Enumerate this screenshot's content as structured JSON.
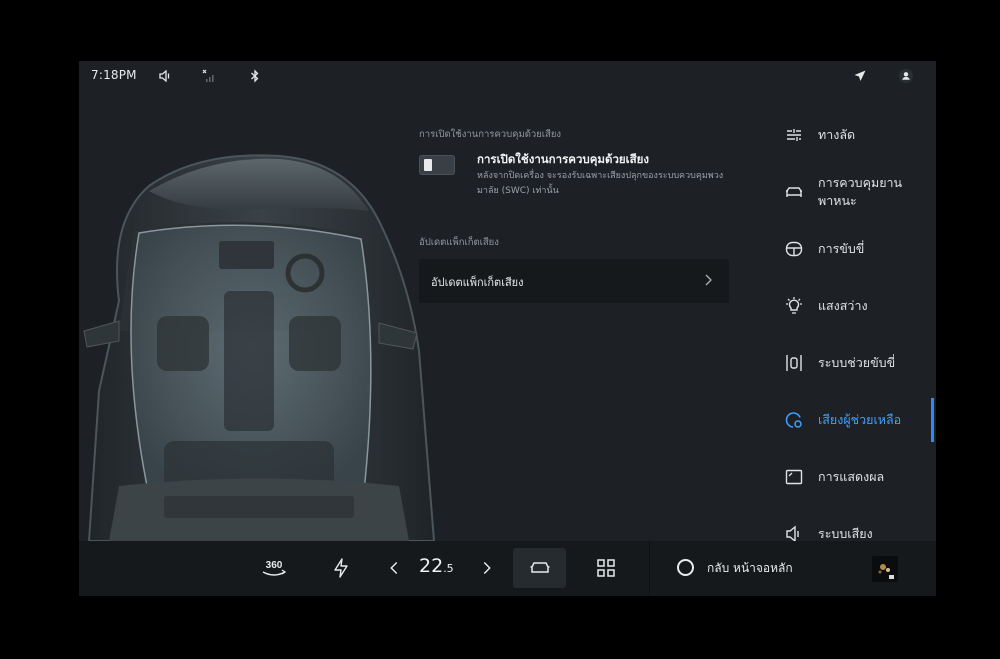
{
  "status_bar": {
    "time": "7:18PM",
    "icons": [
      "volume-icon",
      "signal-icon",
      "bluetooth-icon",
      "navigation-icon",
      "profile-icon"
    ]
  },
  "voice_control": {
    "section_label": "การเปิดใช้งานการควบคุมด้วยเสียง",
    "toggle_title": "การเปิดใช้งานการควบคุมด้วยเสียง",
    "toggle_description": "หลังจากปิดเครื่อง จะรองรับเฉพาะเสียงปลุกของระบบควบคุมพวงมาลัย (SWC) เท่านั้น",
    "toggle_enabled": false
  },
  "voice_pack": {
    "section_label": "อัปเดตแพ็กเก็ตเสียง",
    "row_label": "อัปเดตแพ็กเก็ตเสียง"
  },
  "sidebar": {
    "items": [
      {
        "label": "ทางลัด",
        "icon": "shortcut-icon",
        "active": false
      },
      {
        "label": "การควบคุมยานพาหนะ",
        "icon": "car-icon",
        "active": false
      },
      {
        "label": "การขับขี่",
        "icon": "steering-wheel-icon",
        "active": false
      },
      {
        "label": "แสงสว่าง",
        "icon": "light-bulb-icon",
        "active": false
      },
      {
        "label": "ระบบช่วยขับขี่",
        "icon": "driver-assist-icon",
        "active": false
      },
      {
        "label": "เสียงผู้ช่วยเหลือ",
        "icon": "voice-assistant-icon",
        "active": true
      },
      {
        "label": "การแสดงผล",
        "icon": "display-icon",
        "active": false
      },
      {
        "label": "ระบบเสียง",
        "icon": "speaker-icon",
        "active": false
      }
    ]
  },
  "dock": {
    "camera_label": "360",
    "temperature_whole": "22",
    "temperature_decimal": ".5",
    "home_label": "กลับ หน้าจอหลัก",
    "accent_color": "#2e8cf0"
  }
}
